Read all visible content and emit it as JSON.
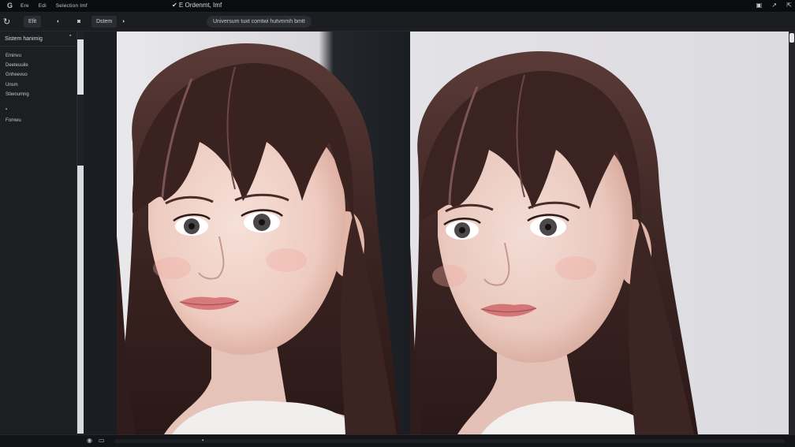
{
  "titlebar": {
    "logo": "G",
    "menu": [
      "Ere",
      "Edi",
      "Selection Imf"
    ],
    "document": "✔ E  Ordenmt, Imf",
    "window_buttons": [
      "▣",
      "↗",
      "⇱"
    ]
  },
  "toolbar": {
    "refresh": "↻",
    "chip_left": "Efit",
    "status_dot": "◐",
    "view_toggle": "◙",
    "mode_chip": "Dstem",
    "mode_dot": "◑",
    "info_pill": "Universum tuxt comtwi hutvmmh bmtt"
  },
  "sidebar": {
    "header": "Sistem hanimig",
    "collapse": "▪",
    "items": [
      "Eminvu",
      "Deeteuuile",
      "Gnheevuo",
      "Unsm",
      "Stiwoumng",
      "▪",
      "Fomwu"
    ]
  },
  "statusbar": {
    "left_icon": "◉",
    "right_icon": "▭",
    "scrubber": "▪"
  },
  "colors": {
    "background": "#111316",
    "panel": "#1c1e22",
    "accent": "#dfe1e4"
  }
}
